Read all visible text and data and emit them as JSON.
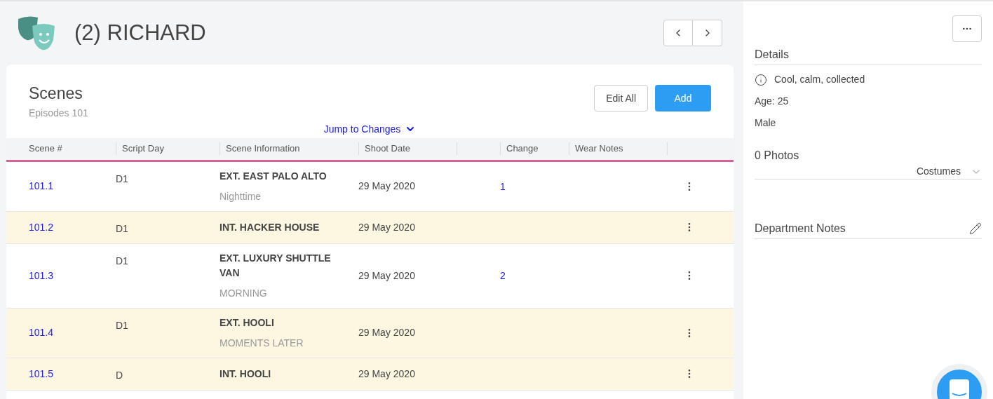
{
  "header": {
    "title": "(2) RICHARD"
  },
  "scenes": {
    "title": "Scenes",
    "subtitle": "Episodes 101",
    "buttons": {
      "edit": "Edit All",
      "add": "Add"
    },
    "jump_link": "Jump to Changes",
    "columns": [
      "Scene #",
      "Script Day",
      "Scene Information",
      "Shoot Date",
      "",
      "Change",
      "Wear Notes",
      ""
    ],
    "rows": [
      {
        "scene": "101.1",
        "day": "D1",
        "location": "EXT. EAST PALO ALTO",
        "time": "Nighttime",
        "date": "29 May 2020",
        "change": "1",
        "highlighted": false
      },
      {
        "scene": "101.2",
        "day": "D1",
        "location": "INT. HACKER HOUSE",
        "date": "29 May 2020",
        "highlighted": true
      },
      {
        "scene": "101.3",
        "day": "D1",
        "location": "EXT. LUXURY SHUTTLE VAN",
        "time": "MORNING",
        "date": "29 May 2020",
        "change": "2",
        "highlighted": false
      },
      {
        "scene": "101.4",
        "day": "D1",
        "location": "EXT. HOOLI",
        "time": "MOMENTS LATER",
        "date": "29 May 2020",
        "highlighted": true
      },
      {
        "scene": "101.5",
        "day": "D",
        "location": "INT. HOOLI",
        "date": "29 May 2020",
        "highlighted": true
      }
    ]
  },
  "details": {
    "title": "Details",
    "description": "Cool, calm, collected",
    "age": "Age: 25",
    "gender": "Male"
  },
  "photos": {
    "title": "0 Photos",
    "filter": "Costumes"
  },
  "notes": {
    "title": "Department Notes"
  }
}
